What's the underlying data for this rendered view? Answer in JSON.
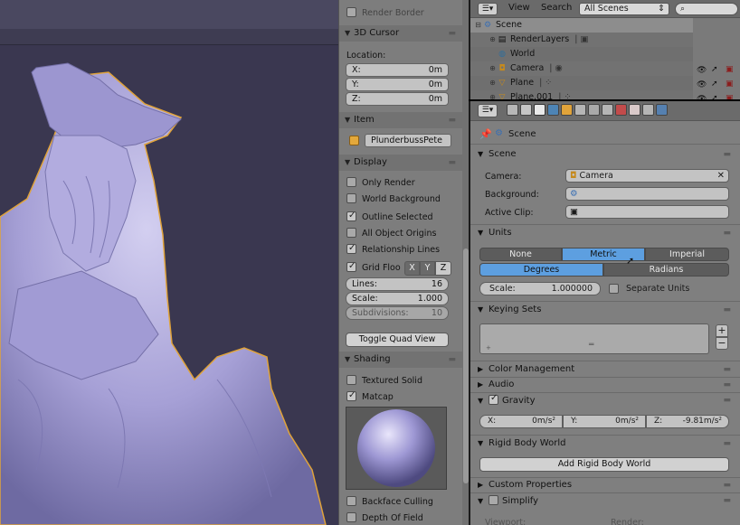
{
  "viewport": {
    "model": "PlunderbussPete"
  },
  "npanel": {
    "render_border": "Render Border",
    "cursor": {
      "title": "3D Cursor",
      "location_label": "Location:",
      "x_label": "X:",
      "x": "0m",
      "y_label": "Y:",
      "y": "0m",
      "z_label": "Z:",
      "z": "0m"
    },
    "item": {
      "title": "Item",
      "name": "PlunderbussPete"
    },
    "display": {
      "title": "Display",
      "only_render": "Only Render",
      "world_background": "World Background",
      "outline_selected": "Outline Selected",
      "all_object_origins": "All Object Origins",
      "relationship_lines": "Relationship Lines",
      "grid_floor": "Grid Floo",
      "axis_x": "X",
      "axis_y": "Y",
      "axis_z": "Z",
      "lines_label": "Lines:",
      "lines": "16",
      "scale_label": "Scale:",
      "scale": "1.000",
      "subdivisions_label": "Subdivisions:",
      "subdivisions": "10",
      "toggle_quad": "Toggle Quad View"
    },
    "shading": {
      "title": "Shading",
      "textured_solid": "Textured Solid",
      "matcap": "Matcap",
      "backface_culling": "Backface Culling",
      "depth_of_field": "Depth Of Field"
    }
  },
  "outliner": {
    "menu_view": "View",
    "menu_search": "Search",
    "display_mode": "All Scenes",
    "rows": [
      {
        "label": "Scene"
      },
      {
        "label": "RenderLayers"
      },
      {
        "label": "World"
      },
      {
        "label": "Camera"
      },
      {
        "label": "Plane"
      },
      {
        "label": "Plane.001"
      }
    ]
  },
  "properties": {
    "breadcrumb": "Scene",
    "scene": {
      "title": "Scene",
      "camera_label": "Camera:",
      "camera": "Camera",
      "background_label": "Background:",
      "active_clip_label": "Active Clip:"
    },
    "units": {
      "title": "Units",
      "system": [
        "None",
        "Metric",
        "Imperial"
      ],
      "rotation": [
        "Degrees",
        "Radians"
      ],
      "scale_label": "Scale:",
      "scale": "1.000000",
      "separate_units": "Separate Units"
    },
    "keying_sets": {
      "title": "Keying Sets"
    },
    "color_management": "Color Management",
    "audio": "Audio",
    "gravity": {
      "title": "Gravity",
      "x_label": "X:",
      "x": "0m/s²",
      "y_label": "Y:",
      "y": "0m/s²",
      "z_label": "Z:",
      "z": "-9.81m/s²"
    },
    "rigid_body_world": {
      "title": "Rigid Body World",
      "add_button": "Add Rigid Body World"
    },
    "custom_properties": "Custom Properties",
    "simplify": {
      "title": "Simplify",
      "viewport_label": "Viewport:",
      "render_label": "Render:"
    }
  },
  "colors": {
    "accent_blue": "#5d9fe0",
    "viewport_bg": "#3a3750",
    "sculpt": "#a9a3d8",
    "outline": "#e0a33a"
  }
}
